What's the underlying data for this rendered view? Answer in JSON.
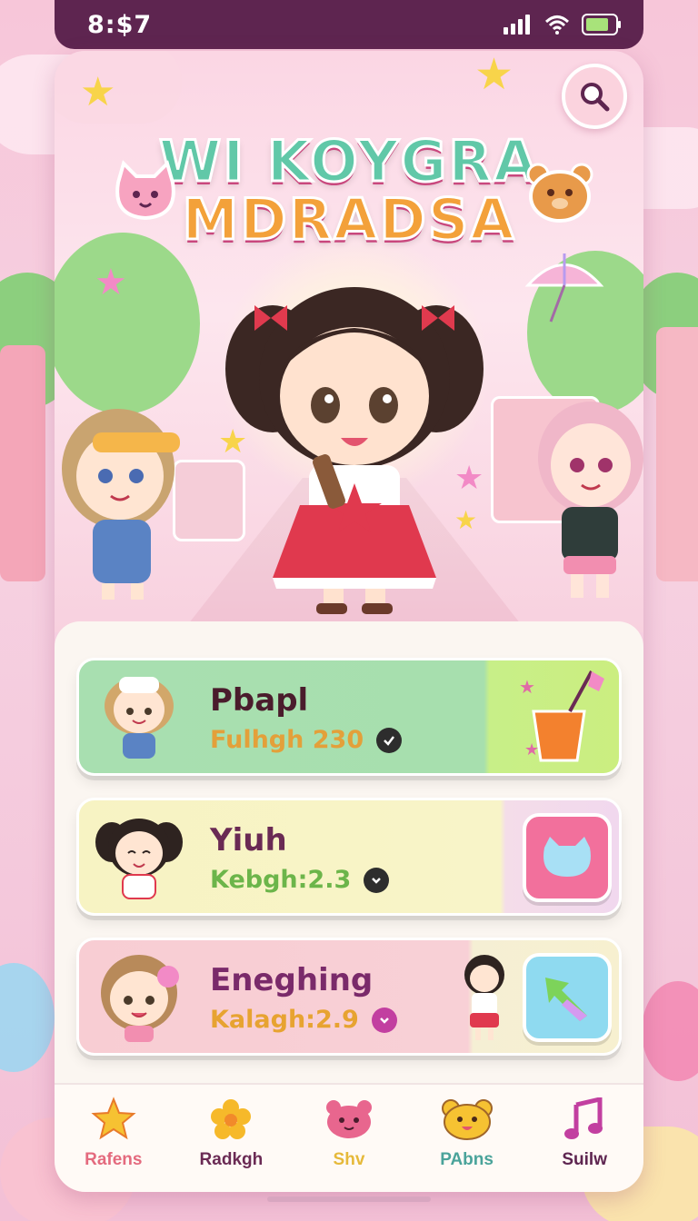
{
  "status_bar": {
    "time": "8:$7"
  },
  "hero": {
    "title_line1": "WI KOYGRA",
    "title_line2": "MDRADSA"
  },
  "quests": [
    {
      "title": "Pbapl",
      "subtitle": "Fulhgh 230",
      "title_color": "#4a1c2c",
      "subtitle_color": "#e3a03a",
      "check_color": "#2d2d2d"
    },
    {
      "title": "Yiuh",
      "subtitle": "Kebgh:2.3",
      "title_color": "#6a2a54",
      "subtitle_color": "#6cb54a",
      "check_color": "#2d2d2d"
    },
    {
      "title": "Eneghing",
      "subtitle": "Kalagh:2.9",
      "title_color": "#7a2a6a",
      "subtitle_color": "#e7a331",
      "check_color": "#c23fa0"
    }
  ],
  "tabs": [
    {
      "label": "Rafens",
      "icon": "star-icon",
      "color": "#e46a7e"
    },
    {
      "label": "Radkgh",
      "icon": "flower-icon",
      "color": "#6a2a54"
    },
    {
      "label": "Shv",
      "icon": "bear-icon",
      "color": "#e6b93a"
    },
    {
      "label": "PAbns",
      "icon": "bear-face-icon",
      "color": "#4aa39a"
    },
    {
      "label": "Suilw",
      "icon": "music-note-icon",
      "color": "#5e2550"
    }
  ]
}
